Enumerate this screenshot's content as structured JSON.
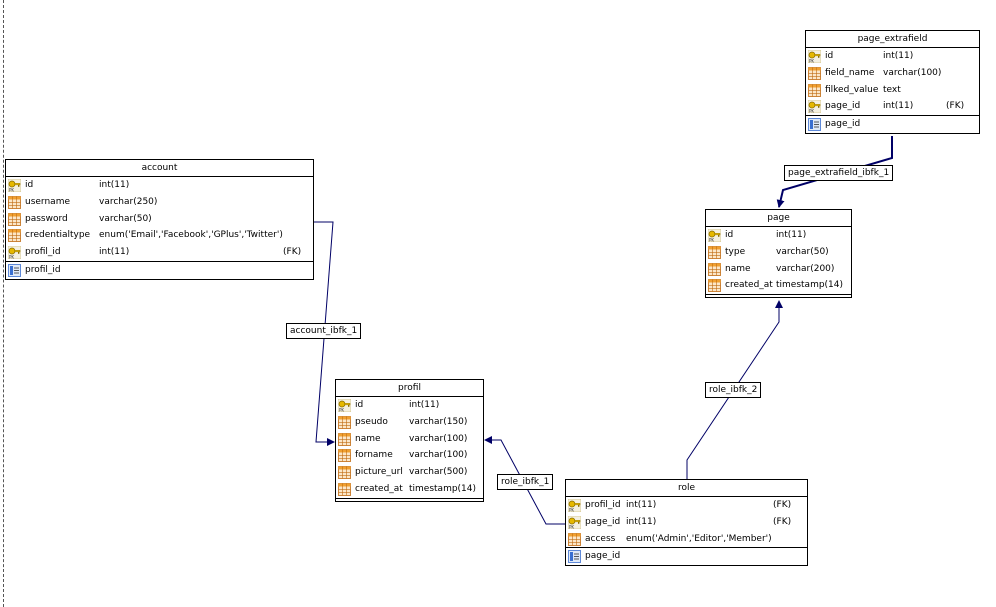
{
  "tables": {
    "account": {
      "name": "account",
      "columns": [
        {
          "name": "id",
          "type": "int(11)",
          "flag": "",
          "icon": "key-icon"
        },
        {
          "name": "username",
          "type": "varchar(250)",
          "flag": "",
          "icon": "column-icon"
        },
        {
          "name": "password",
          "type": "varchar(50)",
          "flag": "",
          "icon": "column-icon"
        },
        {
          "name": "credentialtype",
          "type": "enum('Email','Facebook','GPlus','Twitter')",
          "flag": "",
          "icon": "column-icon"
        },
        {
          "name": "profil_id",
          "type": "int(11)",
          "flag": "(FK)",
          "icon": "key-icon"
        }
      ],
      "indexes": [
        {
          "name": "profil_id",
          "icon": "index-icon"
        }
      ]
    },
    "profil": {
      "name": "profil",
      "columns": [
        {
          "name": "id",
          "type": "int(11)",
          "flag": "",
          "icon": "key-icon"
        },
        {
          "name": "pseudo",
          "type": "varchar(150)",
          "flag": "",
          "icon": "column-icon"
        },
        {
          "name": "name",
          "type": "varchar(100)",
          "flag": "",
          "icon": "column-icon"
        },
        {
          "name": "forname",
          "type": "varchar(100)",
          "flag": "",
          "icon": "column-icon"
        },
        {
          "name": "picture_url",
          "type": "varchar(500)",
          "flag": "",
          "icon": "column-icon"
        },
        {
          "name": "created_at",
          "type": "timestamp(14)",
          "flag": "",
          "icon": "column-icon"
        }
      ],
      "indexes": []
    },
    "page_extrafield": {
      "name": "page_extrafield",
      "columns": [
        {
          "name": "id",
          "type": "int(11)",
          "flag": "",
          "icon": "key-icon"
        },
        {
          "name": "field_name",
          "type": "varchar(100)",
          "flag": "",
          "icon": "column-icon"
        },
        {
          "name": "filked_value",
          "type": "text",
          "flag": "",
          "icon": "column-icon"
        },
        {
          "name": "page_id",
          "type": "int(11)",
          "flag": "(FK)",
          "icon": "key-icon"
        }
      ],
      "indexes": [
        {
          "name": "page_id",
          "icon": "index-icon"
        }
      ]
    },
    "page": {
      "name": "page",
      "columns": [
        {
          "name": "id",
          "type": "int(11)",
          "flag": "",
          "icon": "key-icon"
        },
        {
          "name": "type",
          "type": "varchar(50)",
          "flag": "",
          "icon": "column-icon"
        },
        {
          "name": "name",
          "type": "varchar(200)",
          "flag": "",
          "icon": "column-icon"
        },
        {
          "name": "created_at",
          "type": "timestamp(14)",
          "flag": "",
          "icon": "column-icon"
        }
      ],
      "indexes": []
    },
    "role": {
      "name": "role",
      "columns": [
        {
          "name": "profil_id",
          "type": "int(11)",
          "flag": "(FK)",
          "icon": "key-icon"
        },
        {
          "name": "page_id",
          "type": "int(11)",
          "flag": "(FK)",
          "icon": "key-icon"
        },
        {
          "name": "access",
          "type": "enum('Admin','Editor','Member')",
          "flag": "",
          "icon": "column-icon"
        }
      ],
      "indexes": [
        {
          "name": "page_id",
          "icon": "index-icon"
        }
      ]
    }
  },
  "relations": [
    {
      "name": "account_ibfk_1"
    },
    {
      "name": "page_extrafield_ibfk_1"
    },
    {
      "name": "role_ibfk_2"
    },
    {
      "name": "role_ibfk_1"
    }
  ],
  "colors": {
    "link": "#000066",
    "border": "#000000",
    "key_gold": "#e6b800",
    "grid_orange": "#f0a030",
    "index_blue": "#3a6fd0"
  }
}
